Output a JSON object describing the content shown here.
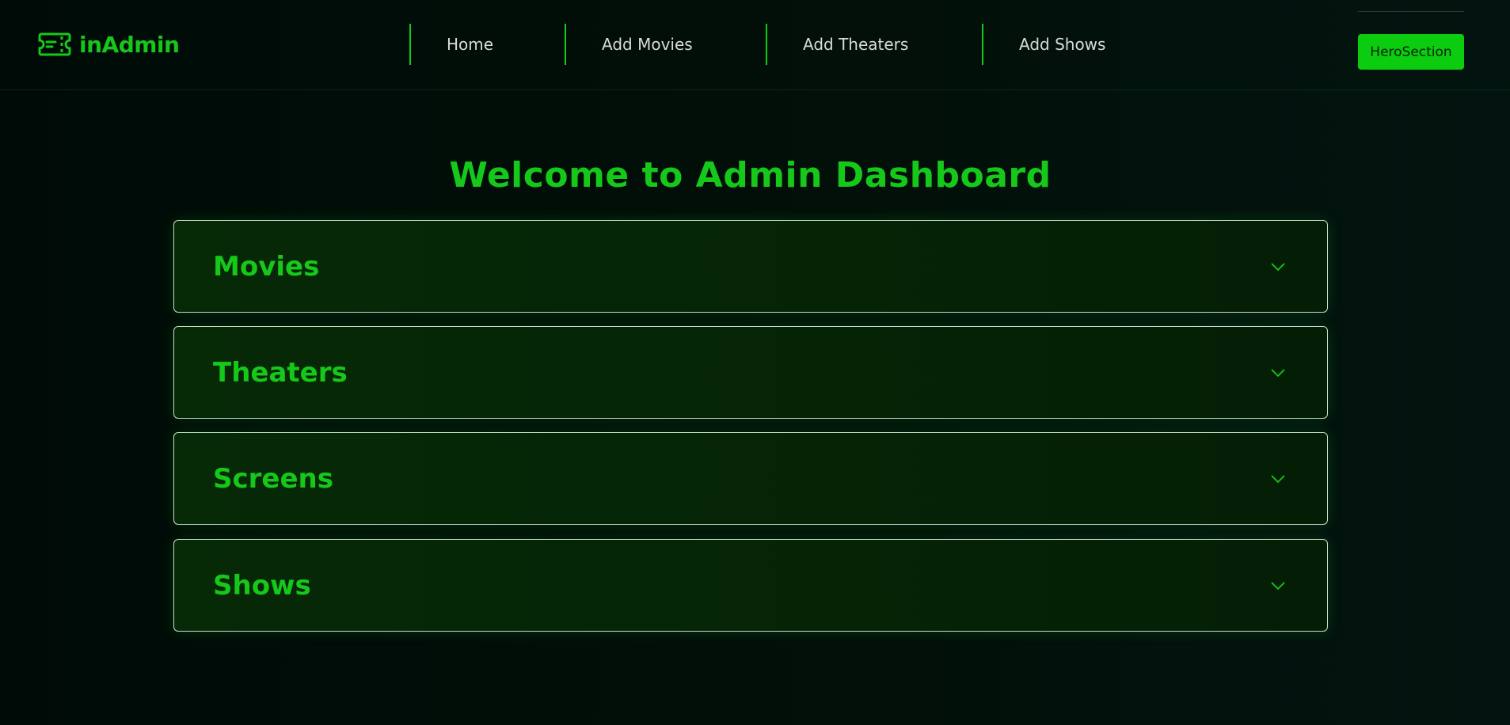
{
  "header": {
    "brand_name": "inAdmin",
    "logo_icon": "ticket-icon",
    "nav": [
      {
        "label": "Home"
      },
      {
        "label": "Add Movies"
      },
      {
        "label": "Add Theaters"
      },
      {
        "label": "Add Shows"
      }
    ],
    "hero_button_label": "HeroSection"
  },
  "main": {
    "title": "Welcome to Admin Dashboard",
    "sections": [
      {
        "label": "Movies",
        "icon": "chevron-down-icon"
      },
      {
        "label": "Theaters",
        "icon": "chevron-down-icon"
      },
      {
        "label": "Screens",
        "icon": "chevron-down-icon"
      },
      {
        "label": "Shows",
        "icon": "chevron-down-icon"
      }
    ]
  },
  "colors": {
    "accent": "#16c81a",
    "button_bg": "#0ccc10",
    "background": "#000b07",
    "nav_text": "#d8dcd8",
    "panel_bg": "#062906",
    "panel_border": "#c8dcc8"
  }
}
